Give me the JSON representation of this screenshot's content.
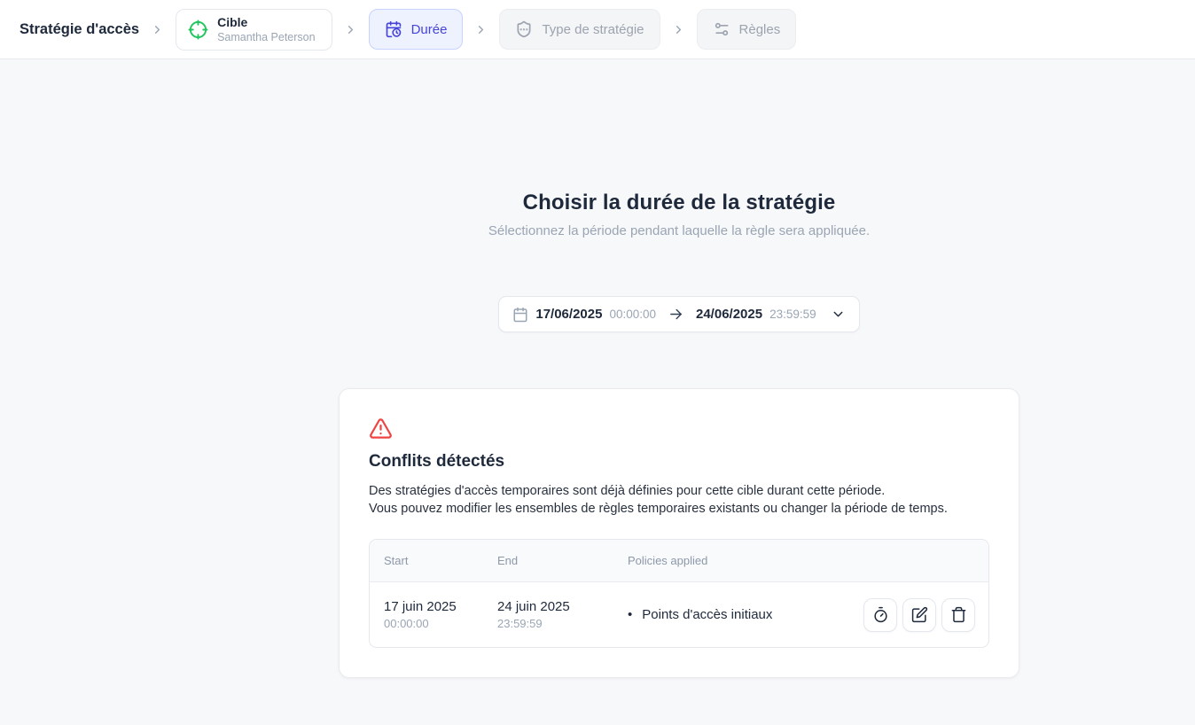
{
  "header": {
    "title": "Stratégie d'accès",
    "steps": {
      "target": {
        "label": "Cible",
        "sublabel": "Samantha Peterson"
      },
      "duration": {
        "label": "Durée"
      },
      "policy_type": {
        "label": "Type de stratégie"
      },
      "rules": {
        "label": "Règles"
      }
    }
  },
  "main": {
    "title": "Choisir la durée de la stratégie",
    "subtitle": "Sélectionnez la période pendant laquelle la règle sera appliquée.",
    "date_range": {
      "start_date": "17/06/2025",
      "start_time": "00:00:00",
      "end_date": "24/06/2025",
      "end_time": "23:59:59"
    },
    "conflict": {
      "title": "Conflits détectés",
      "description_line1": "Des stratégies d'accès temporaires sont déjà définies pour cette cible durant cette période.",
      "description_line2": "Vous pouvez modifier les ensembles de règles temporaires existants ou changer la période de temps.",
      "table": {
        "bullet": "•",
        "headers": {
          "start": "Start",
          "end": "End",
          "policies": "Policies applied"
        },
        "rows": [
          {
            "start_date": "17 juin 2025",
            "start_time": "00:00:00",
            "end_date": "24 juin 2025",
            "end_time": "23:59:59",
            "policies": [
              "Points d'accès initiaux"
            ]
          }
        ]
      }
    }
  },
  "colors": {
    "accent_indigo": "#4745d8",
    "accent_indigo_bg": "#eef2ff",
    "target_green": "#22c55e",
    "warning_red": "#ef4444",
    "text_dark": "#1e293b",
    "text_muted": "#9aa5b4"
  }
}
